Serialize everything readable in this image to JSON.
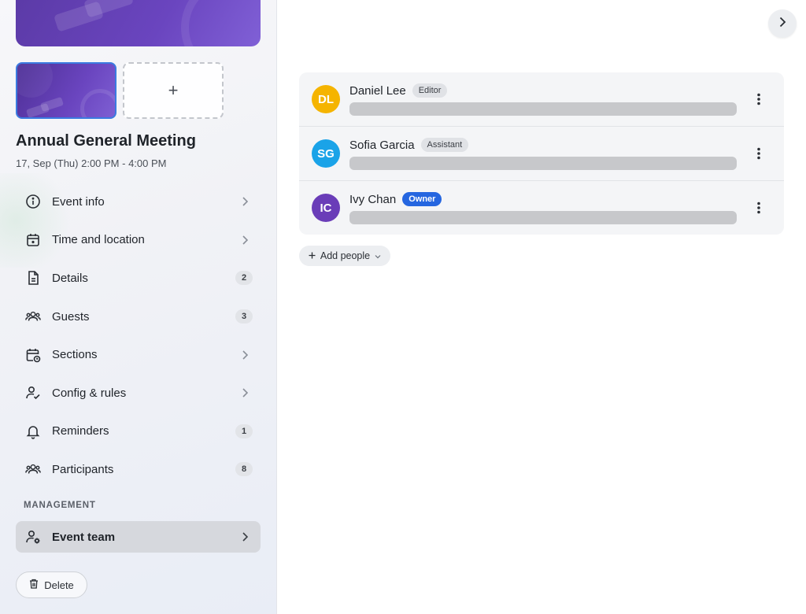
{
  "event": {
    "title": "Annual General Meeting",
    "date": "17, Sep (Thu) 2:00 PM - 4:00 PM",
    "add_cover_label": "+"
  },
  "nav": {
    "items": [
      {
        "label": "Event info",
        "icon": "info-icon",
        "badge": null
      },
      {
        "label": "Time and location",
        "icon": "calendar-icon",
        "badge": null
      },
      {
        "label": "Details",
        "icon": "document-icon",
        "badge": "2"
      },
      {
        "label": "Guests",
        "icon": "group-icon",
        "badge": "3"
      },
      {
        "label": "Sections",
        "icon": "calendar-clock-icon",
        "badge": null
      },
      {
        "label": "Config & rules",
        "icon": "user-check-icon",
        "badge": null
      },
      {
        "label": "Reminders",
        "icon": "bell-icon",
        "badge": "1"
      },
      {
        "label": "Participants",
        "icon": "group-icon",
        "badge": "8"
      }
    ],
    "management_label": "MANAGEMENT",
    "event_team_label": "Event team",
    "delete_label": "Delete"
  },
  "team": {
    "members": [
      {
        "initials": "DL",
        "name": "Daniel Lee",
        "role": "Editor",
        "color": "#f5b400"
      },
      {
        "initials": "SG",
        "name": "Sofia Garcia",
        "role": "Assistant",
        "color": "#1aa3e8"
      },
      {
        "initials": "IC",
        "name": "Ivy Chan",
        "role": "Owner",
        "color": "#6a3db8"
      }
    ],
    "add_people_label": "Add people"
  },
  "colors": {
    "accent": "#2566e0",
    "active_nav": "#d6d8dd"
  }
}
